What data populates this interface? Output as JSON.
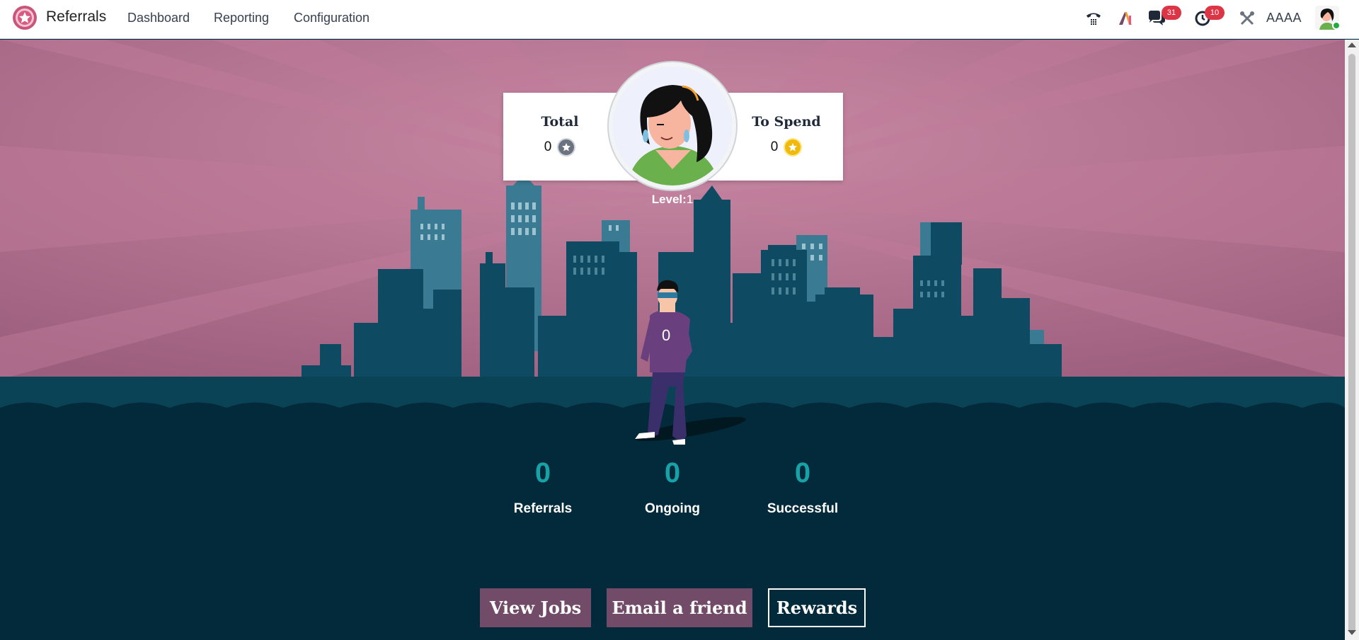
{
  "navbar": {
    "app_name": "Referrals",
    "menu": [
      "Dashboard",
      "Reporting",
      "Configuration"
    ],
    "messages_count": "31",
    "activities_count": "10",
    "company": "AAAA"
  },
  "points": {
    "total_label": "Total",
    "total_value": "0",
    "to_spend_label": "To Spend",
    "to_spend_value": "0",
    "level_label": "Level:",
    "level_value": "1"
  },
  "stats": [
    {
      "value": "0",
      "label": "Referrals"
    },
    {
      "value": "0",
      "label": "Ongoing"
    },
    {
      "value": "0",
      "label": "Successful"
    }
  ],
  "actions": {
    "view_jobs": "View Jobs",
    "email_friend": "Email a friend",
    "rewards": "Rewards"
  },
  "colors": {
    "brand": "#714b67",
    "sky": "#b06e8c",
    "ground": "#022a3a",
    "stat_accent": "#17a2a8",
    "badge": "#dc3545"
  },
  "icons": {
    "app_logo": "referrals-star-logo",
    "phone": "voip-phone-icon",
    "ai": "ai-icon",
    "messages": "chat-icon",
    "activities": "clock-icon",
    "debug": "tools-icon"
  }
}
